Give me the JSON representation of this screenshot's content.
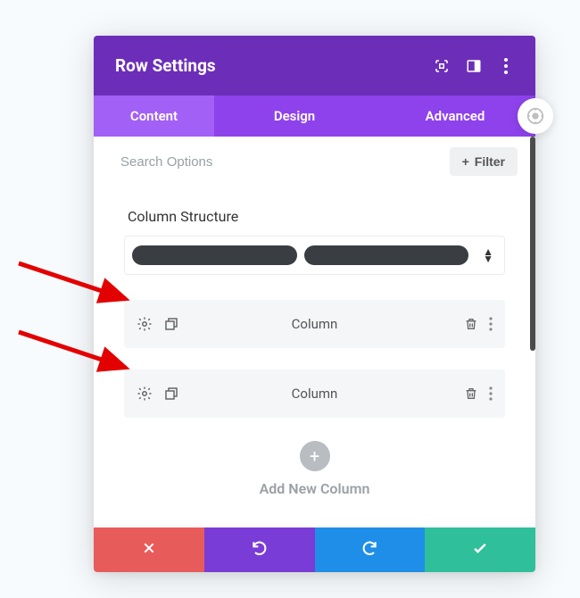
{
  "header": {
    "title": "Row Settings"
  },
  "tabs": {
    "content": "Content",
    "design": "Design",
    "advanced": "Advanced"
  },
  "search": {
    "placeholder": "Search Options",
    "filter_label": "Filter"
  },
  "structure": {
    "title": "Column Structure"
  },
  "columns": [
    {
      "label": "Column"
    },
    {
      "label": "Column"
    }
  ],
  "add": {
    "label": "Add New Column"
  },
  "icons": {
    "plus": "+"
  }
}
